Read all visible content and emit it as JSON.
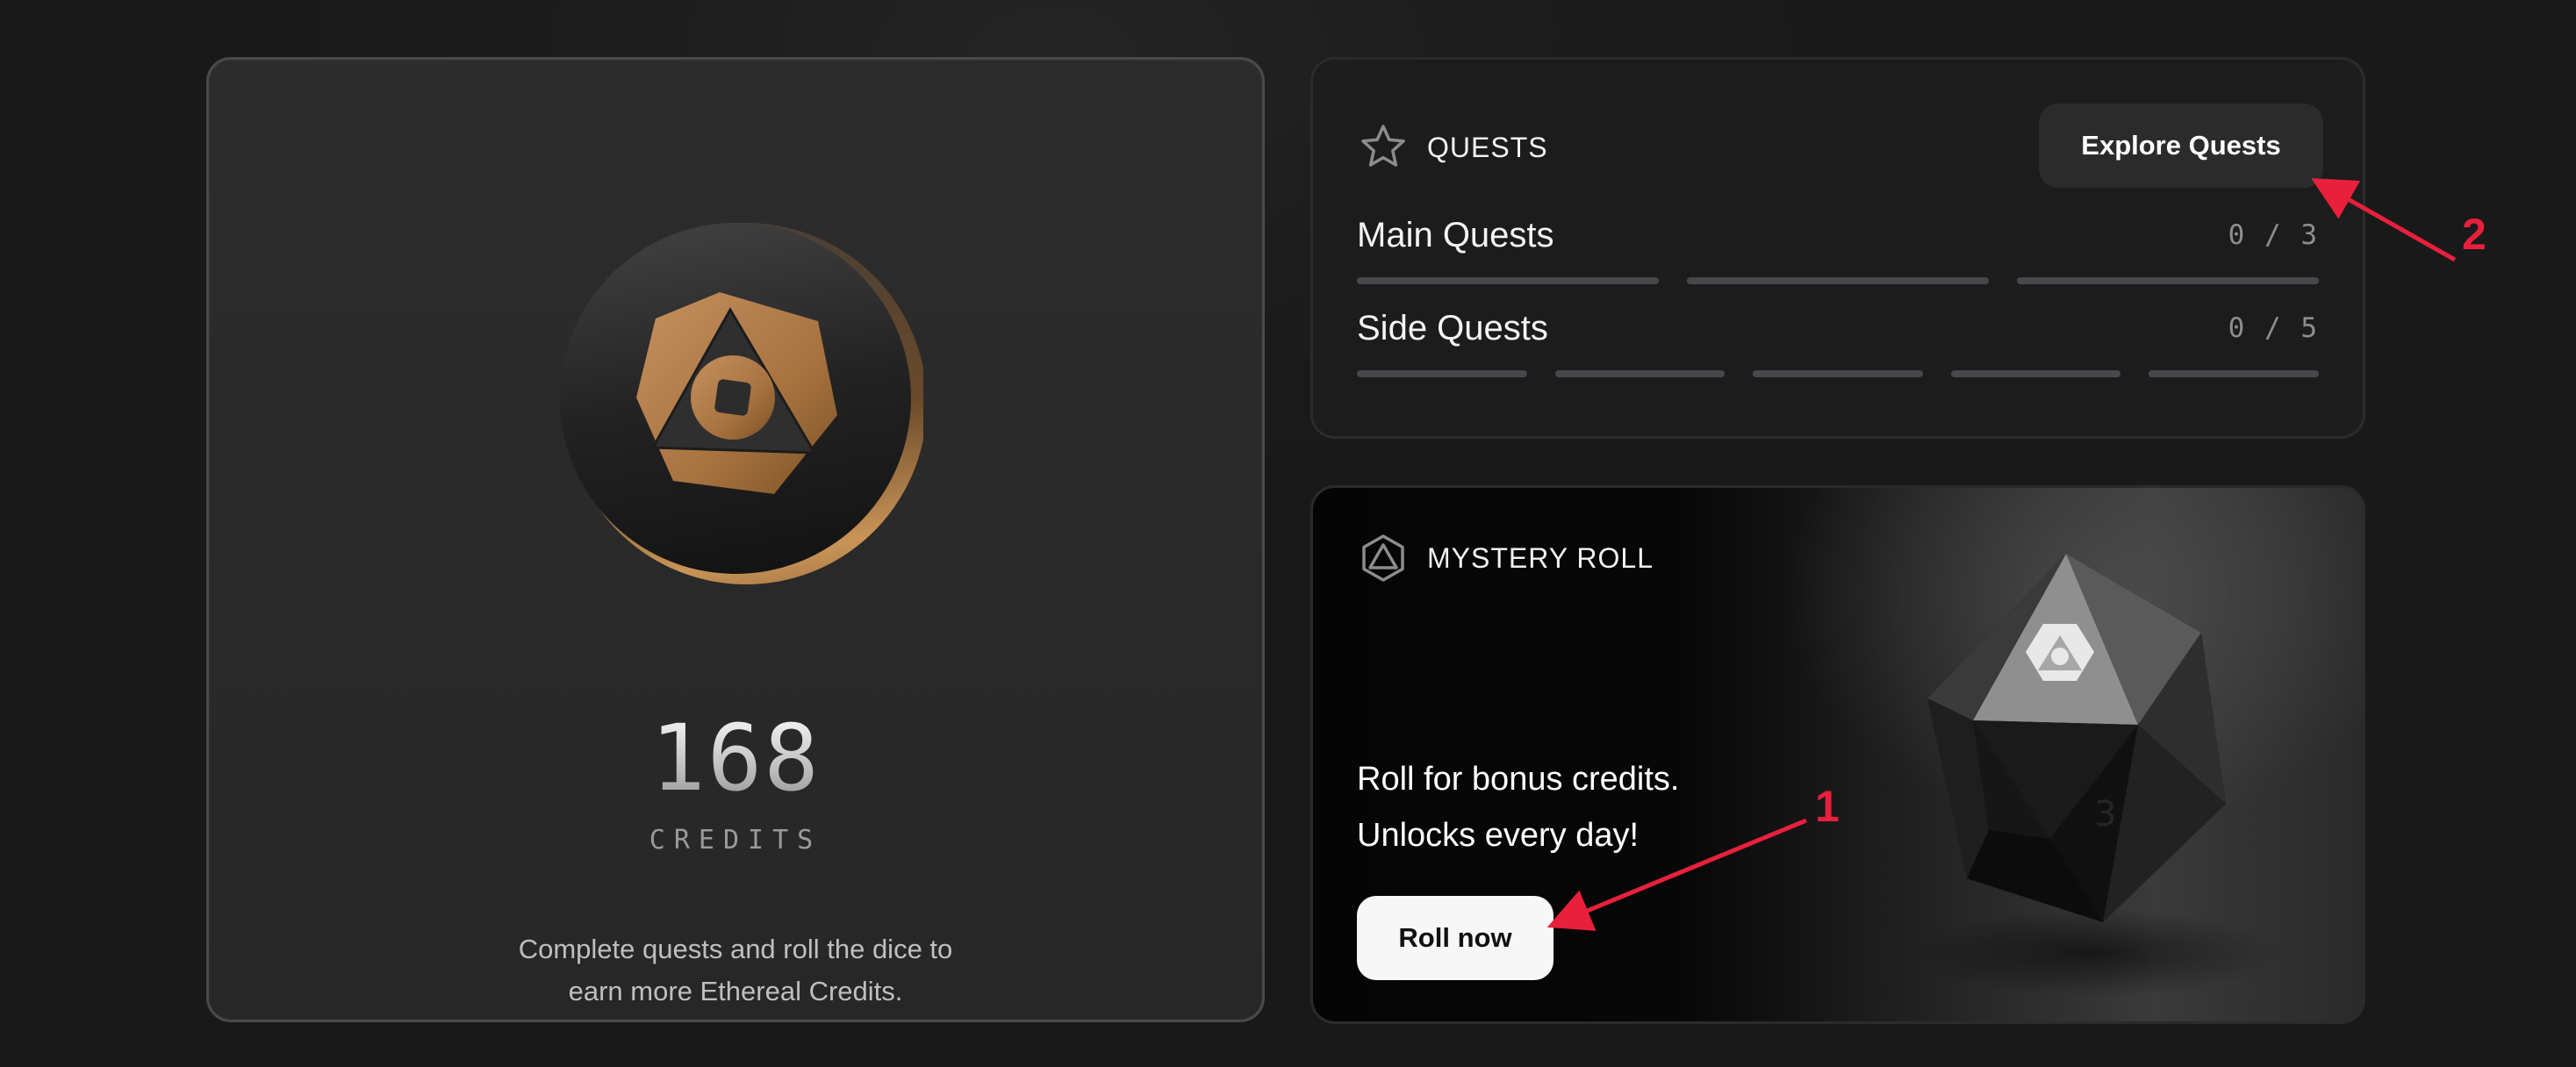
{
  "credits": {
    "amount": "168",
    "label": "CREDITS",
    "description_line1": "Complete quests and roll the dice to",
    "description_line2": "earn more Ethereal Credits.",
    "coin_icon": "ethereal-credit-coin-icon",
    "accent_color": "#b07c45"
  },
  "quests": {
    "title": "QUESTS",
    "icon": "star-icon",
    "explore_label": "Explore Quests",
    "rows": [
      {
        "name": "Main Quests",
        "progress": "0 / 3",
        "completed": 0,
        "total": 3
      },
      {
        "name": "Side Quests",
        "progress": "0 / 5",
        "completed": 0,
        "total": 5
      }
    ]
  },
  "mystery_roll": {
    "title": "MYSTERY ROLL",
    "icon": "d20-outline-icon",
    "line1": "Roll for bonus credits.",
    "line2": "Unlocks every day!",
    "roll_label": "Roll now",
    "image": "d20-dice-image"
  },
  "annotations": [
    {
      "number": "1",
      "target": "roll-now-button"
    },
    {
      "number": "2",
      "target": "explore-quests-button"
    }
  ],
  "colors": {
    "background": "#1c1c1c",
    "card": "#2a2a2a",
    "annotation": "#e8203c",
    "progress_empty": "#48484c"
  }
}
